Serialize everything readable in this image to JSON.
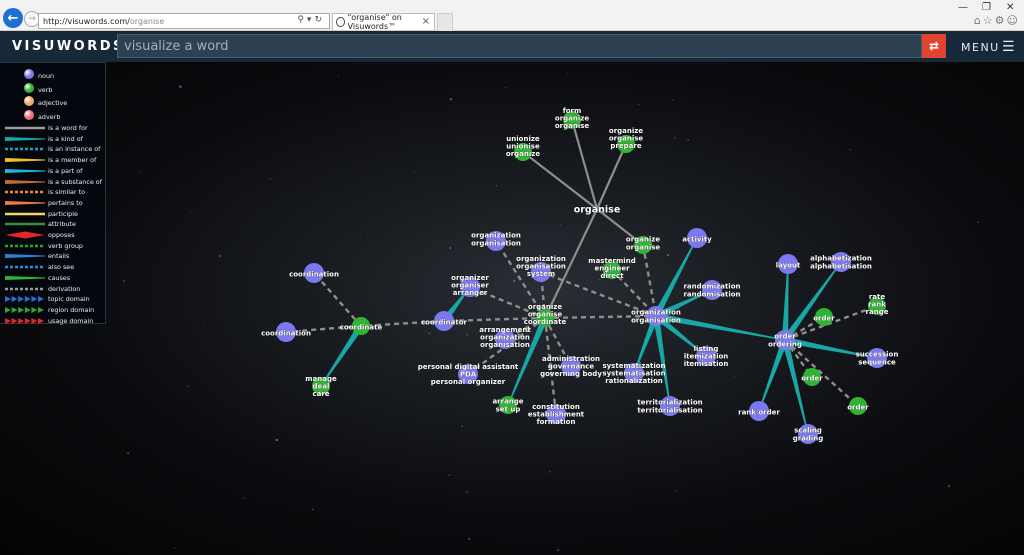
{
  "browser": {
    "url_host": "http://visuwords.com/",
    "url_path": "organise",
    "tab_title": "\"organise\" on Visuwords™",
    "tab_close": "×",
    "win_min": "—",
    "win_restore": "❐",
    "win_close": "✕"
  },
  "header": {
    "logo": "VISUWORDS™",
    "search_placeholder": "visualize a word",
    "menu_label": "MENU"
  },
  "legend": {
    "pos": [
      {
        "label": "noun",
        "color": "#7b78f0"
      },
      {
        "label": "verb",
        "color": "#2fb533"
      },
      {
        "label": "adjective",
        "color": "#f2a86a"
      },
      {
        "label": "adverb",
        "color": "#ef6f77"
      }
    ],
    "relations": [
      {
        "label": "is a word for",
        "color": "#9a9a9a",
        "style": "solid"
      },
      {
        "label": "is a kind of",
        "color": "#18a6a6",
        "style": "taper"
      },
      {
        "label": "is an instance of",
        "color": "#18a6a6",
        "style": "dash"
      },
      {
        "label": "is a member of",
        "color": "#f3c21a",
        "style": "taper"
      },
      {
        "label": "is a part of",
        "color": "#1eb7d6",
        "style": "taper"
      },
      {
        "label": "is a substance of",
        "color": "#c46b2e",
        "style": "taper"
      },
      {
        "label": "is similar to",
        "color": "#f08a2a",
        "style": "dash"
      },
      {
        "label": "pertains to",
        "color": "#f07a45",
        "style": "taper"
      },
      {
        "label": "participle",
        "color": "#f2d86a",
        "style": "solid"
      },
      {
        "label": "attribute",
        "color": "#3a8d3a",
        "style": "solid"
      },
      {
        "label": "opposes",
        "color": "#e0282a",
        "style": "diamond"
      },
      {
        "label": "verb group",
        "color": "#2fa52f",
        "style": "dash"
      },
      {
        "label": "entails",
        "color": "#2b7fd6",
        "style": "taper"
      },
      {
        "label": "also see",
        "color": "#2b8bd6",
        "style": "dash"
      },
      {
        "label": "causes",
        "color": "#2fb533",
        "style": "taper"
      },
      {
        "label": "derivation",
        "color": "#9a9a9a",
        "style": "dash"
      },
      {
        "label": "topic domain",
        "color": "#2b6fd6",
        "style": "arrows"
      },
      {
        "label": "region domain",
        "color": "#2fa52f",
        "style": "arrows"
      },
      {
        "label": "usage domain",
        "color": "#e0282a",
        "style": "arrows"
      }
    ]
  },
  "graph": {
    "center": "organise",
    "nodes": [
      {
        "id": "organise",
        "type": "word",
        "lines": [
          "organise"
        ]
      },
      {
        "id": "form",
        "type": "verb",
        "lines": [
          "form",
          "organize",
          "organise"
        ]
      },
      {
        "id": "unionize",
        "type": "verb",
        "lines": [
          "unionize",
          "unionise",
          "organize"
        ]
      },
      {
        "id": "prepare",
        "type": "verb",
        "lines": [
          "organize",
          "organise",
          "prepare"
        ]
      },
      {
        "id": "orgorg_top",
        "type": "verb",
        "lines": [
          "organize",
          "organise"
        ]
      },
      {
        "id": "mastermind",
        "type": "verb",
        "lines": [
          "mastermind",
          "engineer",
          "direct"
        ]
      },
      {
        "id": "coordinate",
        "type": "verb",
        "lines": [
          "organize",
          "organise",
          "coordinate"
        ]
      },
      {
        "id": "orgsystem",
        "type": "noun",
        "lines": [
          "organization",
          "organisation",
          "system"
        ]
      },
      {
        "id": "organization_left",
        "type": "noun",
        "lines": [
          "organization",
          "organisation"
        ]
      },
      {
        "id": "organizer",
        "type": "noun",
        "lines": [
          "organizer",
          "organiser",
          "arranger"
        ]
      },
      {
        "id": "coordinator",
        "type": "noun",
        "lines": [
          "coordinator"
        ]
      },
      {
        "id": "coordinate_v",
        "type": "verb",
        "lines": [
          "coordinate"
        ]
      },
      {
        "id": "coordination1",
        "type": "noun",
        "lines": [
          "coordination"
        ]
      },
      {
        "id": "coordination2",
        "type": "noun",
        "lines": [
          "coordination"
        ]
      },
      {
        "id": "manage",
        "type": "verb",
        "lines": [
          "manage",
          "deal",
          "care"
        ]
      },
      {
        "id": "arrangement",
        "type": "noun",
        "lines": [
          "arrangement",
          "organization",
          "organisation"
        ]
      },
      {
        "id": "pda",
        "type": "noun",
        "lines": [
          "personal digital assistant",
          "PDA",
          "personal organizer"
        ]
      },
      {
        "id": "arrange",
        "type": "verb",
        "lines": [
          "arrange",
          "set up"
        ]
      },
      {
        "id": "constitution",
        "type": "noun",
        "lines": [
          "constitution",
          "establishment",
          "formation"
        ]
      },
      {
        "id": "administration",
        "type": "noun",
        "lines": [
          "administration",
          "governance",
          "governing body"
        ]
      },
      {
        "id": "org_center",
        "type": "noun",
        "lines": [
          "organization",
          "organisation"
        ]
      },
      {
        "id": "activity",
        "type": "noun",
        "lines": [
          "activity"
        ]
      },
      {
        "id": "randomization",
        "type": "noun",
        "lines": [
          "randomization",
          "randomisation"
        ]
      },
      {
        "id": "listing",
        "type": "noun",
        "lines": [
          "listing",
          "itemization",
          "itemisation"
        ]
      },
      {
        "id": "systematization",
        "type": "noun",
        "lines": [
          "systematization",
          "systematisation",
          "rationalization"
        ]
      },
      {
        "id": "territorialization",
        "type": "noun",
        "lines": [
          "territorialization",
          "territorialisation"
        ]
      },
      {
        "id": "order_ordering",
        "type": "noun",
        "lines": [
          "order",
          "ordering"
        ]
      },
      {
        "id": "layout",
        "type": "noun",
        "lines": [
          "layout"
        ]
      },
      {
        "id": "alphabetization",
        "type": "noun",
        "lines": [
          "alphabetization",
          "alphabetisation"
        ]
      },
      {
        "id": "order_v1",
        "type": "verb",
        "lines": [
          "order"
        ]
      },
      {
        "id": "rate",
        "type": "verb",
        "lines": [
          "rate",
          "rank",
          "range"
        ]
      },
      {
        "id": "succession",
        "type": "noun",
        "lines": [
          "succession",
          "sequence"
        ]
      },
      {
        "id": "order_v2",
        "type": "verb",
        "lines": [
          "order"
        ]
      },
      {
        "id": "order_v3",
        "type": "verb",
        "lines": [
          "order"
        ]
      },
      {
        "id": "rank_order",
        "type": "noun",
        "lines": [
          "rank order"
        ]
      },
      {
        "id": "scaling",
        "type": "noun",
        "lines": [
          "scaling",
          "grading"
        ]
      }
    ]
  }
}
